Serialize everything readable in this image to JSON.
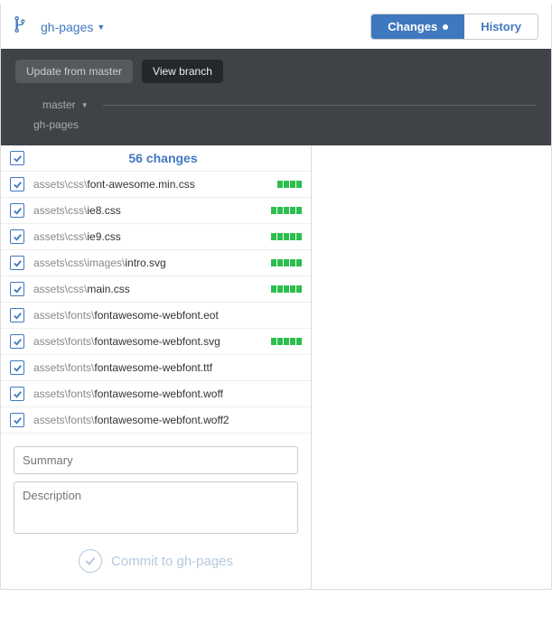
{
  "branch": "gh-pages",
  "tabs": {
    "changes": "Changes",
    "history": "History"
  },
  "toolbar": {
    "update": "Update from master",
    "view": "View branch"
  },
  "compare": {
    "master": "master",
    "current": "gh-pages"
  },
  "changes_header": "56 changes",
  "files": [
    {
      "dir": "assets\\css\\",
      "name": "font-awesome.min.css",
      "blocks": 4
    },
    {
      "dir": "assets\\css\\",
      "name": "ie8.css",
      "blocks": 5
    },
    {
      "dir": "assets\\css\\",
      "name": "ie9.css",
      "blocks": 5
    },
    {
      "dir": "assets\\css\\images\\",
      "name": "intro.svg",
      "blocks": 5
    },
    {
      "dir": "assets\\css\\",
      "name": "main.css",
      "blocks": 5
    },
    {
      "dir": "assets\\fonts\\",
      "name": "fontawesome-webfont.eot",
      "blocks": 0
    },
    {
      "dir": "assets\\fonts\\",
      "name": "fontawesome-webfont.svg",
      "blocks": 5
    },
    {
      "dir": "assets\\fonts\\",
      "name": "fontawesome-webfont.ttf",
      "blocks": 0
    },
    {
      "dir": "assets\\fonts\\",
      "name": "fontawesome-webfont.woff",
      "blocks": 0
    },
    {
      "dir": "assets\\fonts\\",
      "name": "fontawesome-webfont.woff2",
      "blocks": 0
    }
  ],
  "commit": {
    "summary_placeholder": "Summary",
    "description_placeholder": "Description",
    "button": "Commit to gh-pages"
  }
}
